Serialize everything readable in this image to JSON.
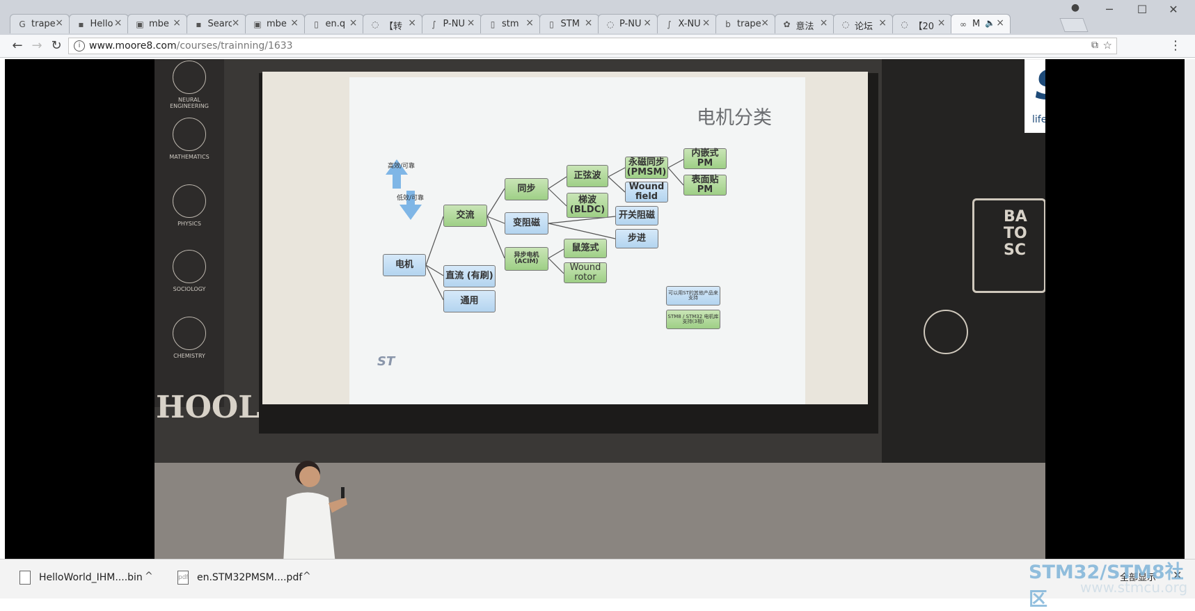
{
  "browser": {
    "tabs": [
      {
        "icon": "google-icon",
        "label": "trape"
      },
      {
        "icon": "page-icon",
        "label": "Hello"
      },
      {
        "icon": "arm-icon",
        "label": "mbe"
      },
      {
        "icon": "page-icon",
        "label": "Searc"
      },
      {
        "icon": "arm-icon",
        "label": "mbe"
      },
      {
        "icon": "document-icon",
        "label": "en.q"
      },
      {
        "icon": "loading-icon",
        "label": "【转"
      },
      {
        "icon": "st-icon",
        "label": "P-NU"
      },
      {
        "icon": "document-icon",
        "label": "stm"
      },
      {
        "icon": "document-icon",
        "label": "STM"
      },
      {
        "icon": "loading-icon",
        "label": "P-NU"
      },
      {
        "icon": "st-icon",
        "label": "X-NU"
      },
      {
        "icon": "bing-icon",
        "label": "trape"
      },
      {
        "icon": "forum-icon",
        "label": "意法"
      },
      {
        "icon": "loading-icon",
        "label": "论坛"
      },
      {
        "icon": "loading-icon",
        "label": "【20"
      },
      {
        "icon": "moore8-icon",
        "label": "M",
        "active": true,
        "audio": true
      }
    ],
    "url_host": "www.moore8.com",
    "url_path": "/courses/trainning/1633",
    "window_controls": {
      "minimize": "─",
      "maximize": "☐",
      "close": "✕"
    }
  },
  "video": {
    "subjects": [
      "NEURAL ENGINEERING",
      "MATHEMATICS",
      "PHYSICS",
      "SOCIOLOGY",
      "CHEMISTRY"
    ],
    "wall_text": "HOOL",
    "chalk_text_right": "BA TO SC",
    "logo_tagline": "life.augmented"
  },
  "slide": {
    "title": "电机分类",
    "legend_up": "高效/可靠",
    "legend_down": "低效/可靠",
    "boxes": {
      "motor": "电机",
      "ac": "交流",
      "dc_brushed": "直流 (有刷)",
      "universal": "通用",
      "sync": "同步",
      "reluctance": "变阻磁",
      "async": "异步电机\n(ACIM)",
      "sine": "正弦波",
      "trapezoid": "梯波\n(BLDC)",
      "pmsm": "永磁同步\n(PMSM)",
      "wound_field": "Wound\nfield",
      "ipm": "内嵌式 PM",
      "spm": "表面贴PM",
      "switched_reluctance": "开关阻磁",
      "stepper": "步进",
      "squirrel": "鼠笼式",
      "wound_rotor": "Wound\nrotor",
      "note1": "可以用ST的其他产品来支持",
      "note2": "STM8 / STM32 电机库支持(3相)"
    }
  },
  "downloads": {
    "items": [
      {
        "name": "HelloWorld_IHM....bin"
      },
      {
        "name": "en.STM32PMSM....pdf"
      }
    ],
    "show_all": "全部显示",
    "close": "✕"
  },
  "watermark": {
    "line1": "STM32/STM8社区",
    "line2": "www.stmcu.org"
  }
}
